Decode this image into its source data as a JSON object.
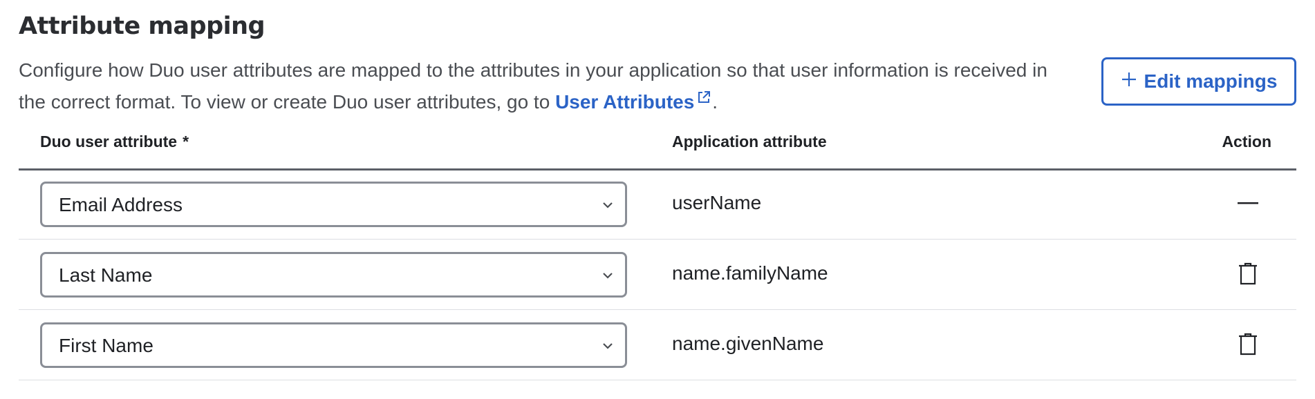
{
  "section": {
    "title": "Attribute mapping",
    "description_prefix": "Configure how Duo user attributes are mapped to the attributes in your application so that user information is received in the correct format. To view or create Duo user attributes, go to ",
    "link_label": "User Attributes",
    "description_suffix": ".",
    "edit_button_label": "Edit mappings"
  },
  "table": {
    "columns": {
      "duo_attribute": "Duo user attribute",
      "required_marker": "*",
      "app_attribute": "Application attribute",
      "action": "Action"
    },
    "rows": [
      {
        "duo_attribute": "Email Address",
        "app_attribute": "userName",
        "action_icon": "dash-icon"
      },
      {
        "duo_attribute": "Last Name",
        "app_attribute": "name.familyName",
        "action_icon": "trash-icon"
      },
      {
        "duo_attribute": "First Name",
        "app_attribute": "name.givenName",
        "action_icon": "trash-icon"
      }
    ]
  },
  "colors": {
    "accent": "#2b63c6",
    "text": "#1f2125",
    "muted_text": "#4a4d52",
    "border": "#8a8e96",
    "divider": "#dcdee2",
    "header_rule": "#5b5f67"
  }
}
